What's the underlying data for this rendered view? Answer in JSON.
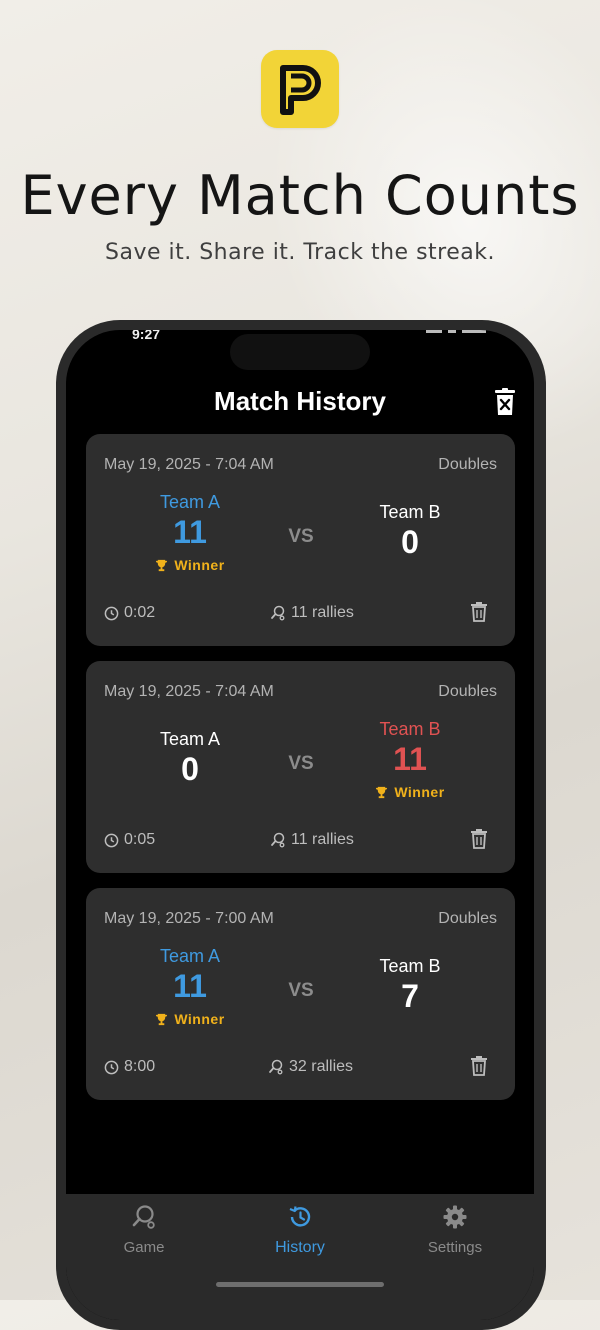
{
  "promo": {
    "headline": "Every Match Counts",
    "subline": "Save it. Share it. Track the streak.",
    "logo_letter": "P",
    "logo_color": "#f2d437"
  },
  "status_bar": {
    "time": "9:27"
  },
  "header": {
    "title": "Match History",
    "clear_icon": "trash-x-icon"
  },
  "matches": [
    {
      "date": "May 19, 2025 - 7:04 AM",
      "mode": "Doubles",
      "team_a": {
        "name": "Team A",
        "score": "11",
        "winner": true
      },
      "team_b": {
        "name": "Team B",
        "score": "0",
        "winner": false
      },
      "vs": "VS",
      "winner_label": "Winner",
      "duration": "0:02",
      "rallies": "11 rallies"
    },
    {
      "date": "May 19, 2025 - 7:04 AM",
      "mode": "Doubles",
      "team_a": {
        "name": "Team A",
        "score": "0",
        "winner": false
      },
      "team_b": {
        "name": "Team B",
        "score": "11",
        "winner": true
      },
      "vs": "VS",
      "winner_label": "Winner",
      "duration": "0:05",
      "rallies": "11 rallies"
    },
    {
      "date": "May 19, 2025 - 7:00 AM",
      "mode": "Doubles",
      "team_a": {
        "name": "Team A",
        "score": "11",
        "winner": true
      },
      "team_b": {
        "name": "Team B",
        "score": "7",
        "winner": false
      },
      "vs": "VS",
      "winner_label": "Winner",
      "duration": "8:00",
      "rallies": "32 rallies"
    }
  ],
  "tabs": [
    {
      "label": "Game",
      "icon": "paddle-icon",
      "active": false
    },
    {
      "label": "History",
      "icon": "history-icon",
      "active": true
    },
    {
      "label": "Settings",
      "icon": "gear-icon",
      "active": false
    }
  ],
  "colors": {
    "team_a_accent": "#3f9ae0",
    "team_b_accent": "#e05252",
    "winner": "#f1b21b",
    "card_bg": "#2e2e2e"
  }
}
